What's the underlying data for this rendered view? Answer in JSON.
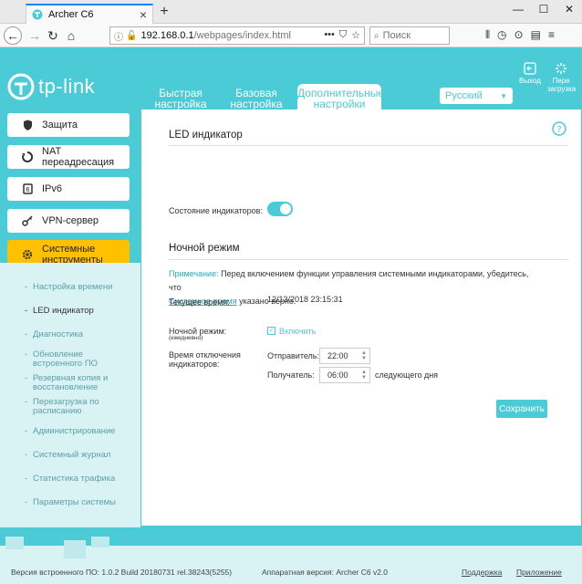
{
  "browser": {
    "tab_title": "Archer C6",
    "url_host": "192.168.0.1",
    "url_path": "/webpages/index.html",
    "search_placeholder": "Поиск"
  },
  "brand": {
    "logo_text": "tp-link"
  },
  "header": {
    "tabs": [
      {
        "label": "Быстрая настройка"
      },
      {
        "label": "Базовая настройка"
      },
      {
        "label": "Дополнительные настройки"
      }
    ],
    "language": "Русский",
    "logout_label": "Выход",
    "reboot_label_1": "Пере",
    "reboot_label_2": "загрузка"
  },
  "sidebar": {
    "items": [
      {
        "label": "Защита",
        "icon": "shield-icon"
      },
      {
        "label": "NAT переадресация",
        "icon": "nat-icon"
      },
      {
        "label": "IPv6",
        "icon": "ipv6-icon"
      },
      {
        "label": "VPN-сервер",
        "icon": "vpn-key-icon"
      },
      {
        "label": "Системные инструменты",
        "icon": "gear-icon"
      }
    ],
    "sub_items": [
      "Настройка времени",
      "LED индикатор",
      "Диагностика",
      "Обновление встроенного ПО",
      "Резервная копия и восстановление",
      "Перезагрузка по расписанию",
      "Администрирование",
      "Системный журнал",
      "Статистика трафика",
      "Параметры системы"
    ]
  },
  "led": {
    "title": "LED индикатор",
    "state_label": "Состояние индикаторов:",
    "state_on": true
  },
  "night": {
    "title": "Ночной режим",
    "note_prefix": "Примечание:",
    "note_text": "Перед включением функции управления системными индикаторами, убедитесь, что",
    "note_link": "Системное время",
    "note_suffix": "указано верно.",
    "current_time_label": "Текущее время:",
    "current_time_value": "12/13/2018 23:15:31",
    "mode_label": "Ночной режим:",
    "mode_sub": "(ежедневно)",
    "enable_label": "Включить",
    "off_time_label_1": "Время отключения",
    "off_time_label_2": "индикаторов:",
    "from_label": "Отправитель:",
    "from_value": "22:00",
    "to_label": "Получатель:",
    "to_value": "06:00",
    "next_day": "следующего дня",
    "save_label": "Сохранить"
  },
  "footer": {
    "firmware": "Версия встроенного ПО: 1.0.2 Build 20180731 rel.38243(5255)",
    "hardware": "Аппаратная версия: Archer C6 v2.0",
    "support": "Поддержка",
    "app": "Приложение"
  },
  "colors": {
    "accent": "#4acbd6",
    "active_menu": "#ffc000"
  }
}
